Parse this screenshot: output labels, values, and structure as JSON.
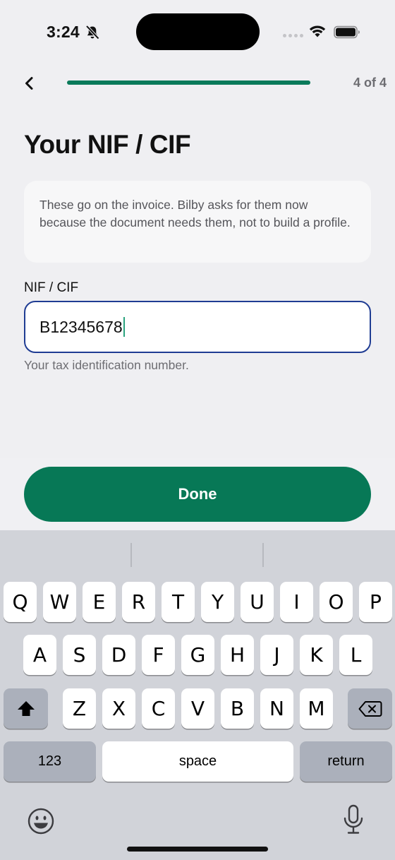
{
  "status_bar": {
    "time": "3:24"
  },
  "nav": {
    "step_counter": "4 of 4",
    "progress_fraction": 1.0
  },
  "page": {
    "title": "Your NIF / CIF",
    "info_text": "These go on the invoice. Bilby asks for them now because the document needs them, not to build a profile."
  },
  "field": {
    "label": "NIF / CIF",
    "value": "B12345678",
    "helper": "Your tax identification number."
  },
  "actions": {
    "done_label": "Done"
  },
  "colors": {
    "accent": "#077856",
    "input_border": "#1f3c93",
    "progress": "#0a7a5a"
  },
  "keyboard": {
    "row1": [
      "Q",
      "W",
      "E",
      "R",
      "T",
      "Y",
      "U",
      "I",
      "O",
      "P"
    ],
    "row2": [
      "A",
      "S",
      "D",
      "F",
      "G",
      "H",
      "J",
      "K",
      "L"
    ],
    "row3": [
      "Z",
      "X",
      "C",
      "V",
      "B",
      "N",
      "M"
    ],
    "numbers_label": "123",
    "space_label": "space",
    "return_label": "return"
  }
}
